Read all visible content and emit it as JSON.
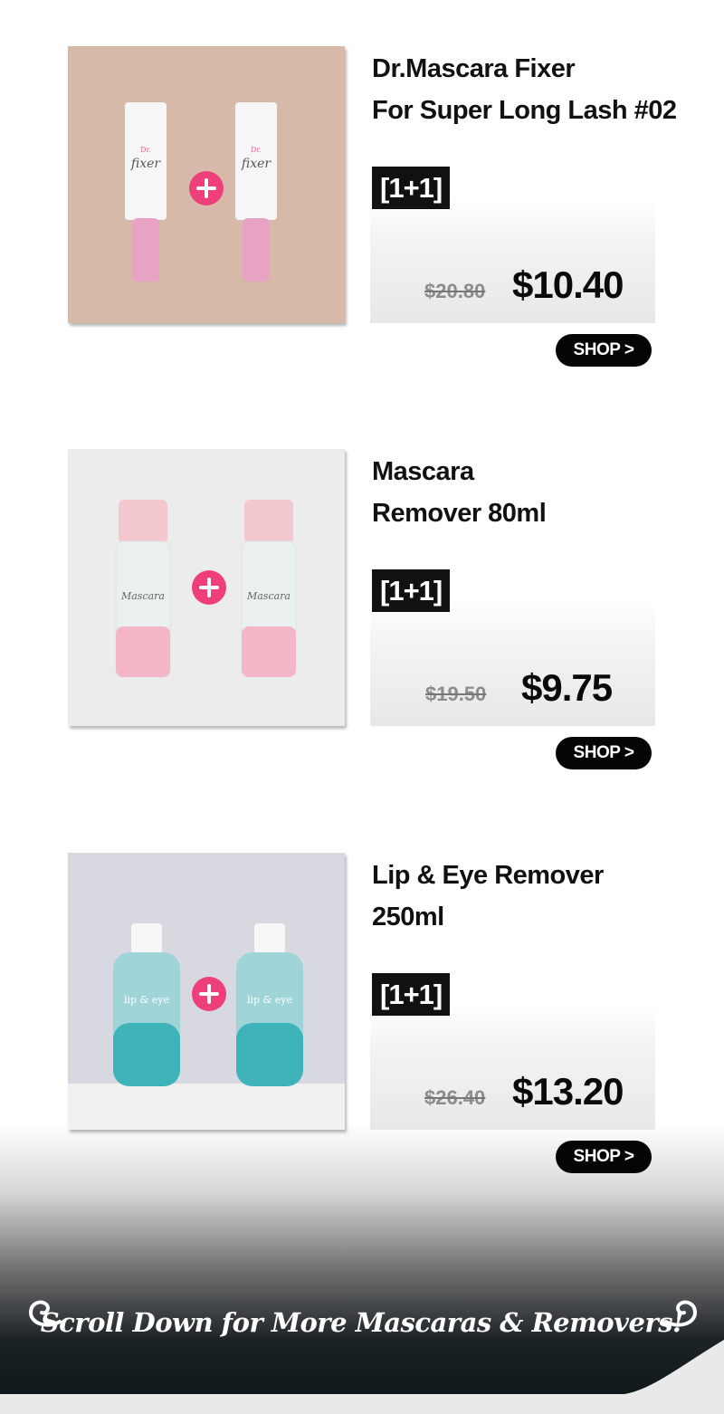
{
  "products": [
    {
      "name": "Dr.Mascara Fixer\nFor Super Long Lash #02",
      "deal": "[1+1]",
      "old_price": "$20.80",
      "new_price": "$10.40",
      "shop_label": "SHOP >",
      "image_bg": "#d6b9a9"
    },
    {
      "name": "Mascara\nRemover 80ml",
      "deal": "[1+1]",
      "old_price": "$19.50",
      "new_price": "$9.75",
      "shop_label": "SHOP >",
      "image_bg": "#ececec"
    },
    {
      "name": "Lip & Eye Remover\n250ml",
      "deal": "[1+1]",
      "old_price": "$26.40",
      "new_price": "$13.20",
      "shop_label": "SHOP >",
      "image_bg": "#d8d8e0"
    }
  ],
  "banner": {
    "text": "Scroll Down for More Mascaras & Removers!",
    "left_icon": "swirl-left-icon",
    "right_icon": "swirl-right-icon"
  },
  "colors": {
    "plus_badge": "#ef3f7a",
    "button_bg": "#050505",
    "badge_bg": "#111111"
  }
}
